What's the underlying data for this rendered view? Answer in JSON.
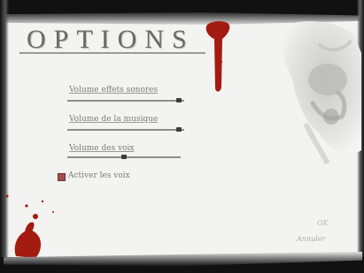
{
  "screen": {
    "title": "OPTIONS"
  },
  "options": {
    "sfx_volume": {
      "label": "Volume effets sonores",
      "level": 0.98
    },
    "music_volume": {
      "label": "Volume de la musique",
      "level": 0.98
    },
    "voice_volume": {
      "label": "Volume des voix",
      "level": 0.5
    },
    "enable_voices": {
      "label": "Activer les voix",
      "checked": true
    }
  },
  "buttons": {
    "ok_label": "OK",
    "cancel_label": "Annuler"
  },
  "colors": {
    "background": "#f3f3f1",
    "blood": "#a41b12",
    "text": "#7b7b7b",
    "checkbox": "#a0504e"
  }
}
